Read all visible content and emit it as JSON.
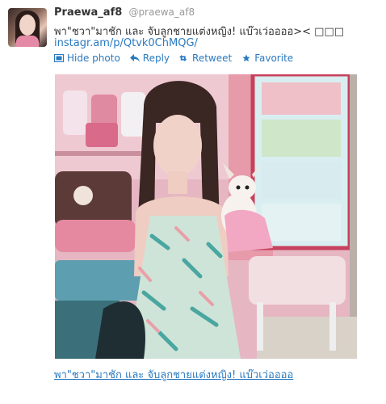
{
  "tweet": {
    "display_name": "Praewa_af8",
    "handle": "@praewa_af8",
    "text": "พา\"ชวา\"มาชัก และ จับลูกชายแต่งหญิง! แบ๊วเว่ออออ>< □□□",
    "link": "instagr.am/p/Qtvk0ChMQG/",
    "caption": "พา\"ชวา\"มาชัก และ จับลูกชายแต่งหญิง! แบ๊วเว่ออออ"
  },
  "actions": {
    "hide_photo": "Hide photo",
    "reply": "Reply",
    "retweet": "Retweet",
    "favorite": "Favorite"
  },
  "icons": [
    "photo-icon",
    "reply-icon",
    "retweet-icon",
    "star-icon"
  ],
  "colors": {
    "link": "#2a7ac0",
    "text": "#333333",
    "muted": "#999999"
  }
}
